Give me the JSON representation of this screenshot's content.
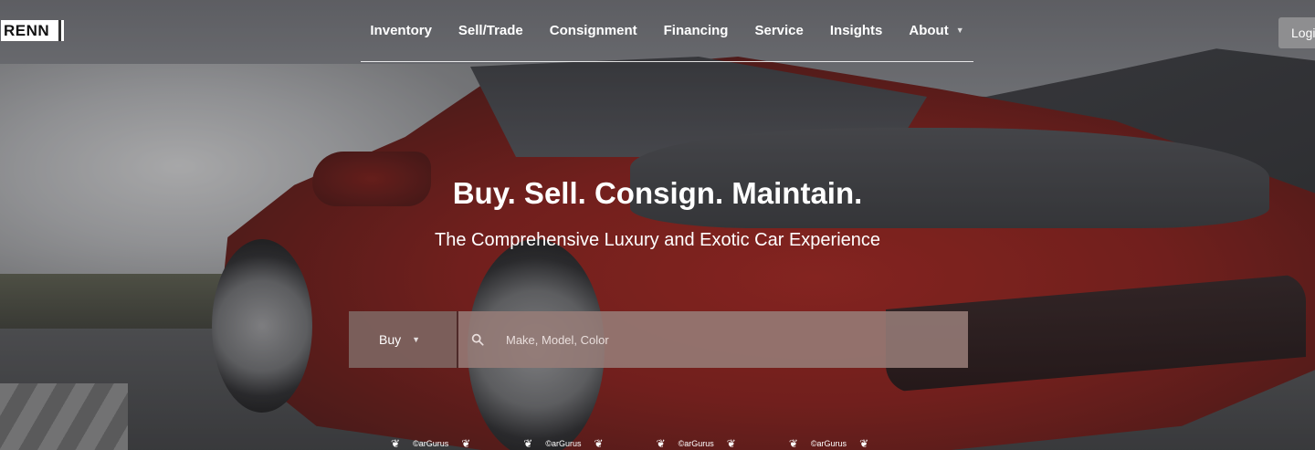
{
  "brand": {
    "logo_text": "RENN"
  },
  "nav": {
    "items": [
      {
        "label": "Inventory"
      },
      {
        "label": "Sell/Trade"
      },
      {
        "label": "Consignment"
      },
      {
        "label": "Financing"
      },
      {
        "label": "Service"
      },
      {
        "label": "Insights"
      },
      {
        "label": "About",
        "has_dropdown": true
      }
    ],
    "login_label": "Logi"
  },
  "hero": {
    "headline": "Buy. Sell. Consign. Maintain.",
    "subheadline": "The Comprehensive Luxury and Exotic Car Experience"
  },
  "search": {
    "mode_selected": "Buy",
    "placeholder": "Make, Model, Color"
  },
  "badges": [
    {
      "text": "©arGurus"
    },
    {
      "text": "©arGurus"
    },
    {
      "text": "©arGurus"
    },
    {
      "text": "©arGurus"
    }
  ],
  "icons": {
    "caret": "chevron-down-icon",
    "search": "search-icon",
    "laurel": "laurel-icon"
  }
}
